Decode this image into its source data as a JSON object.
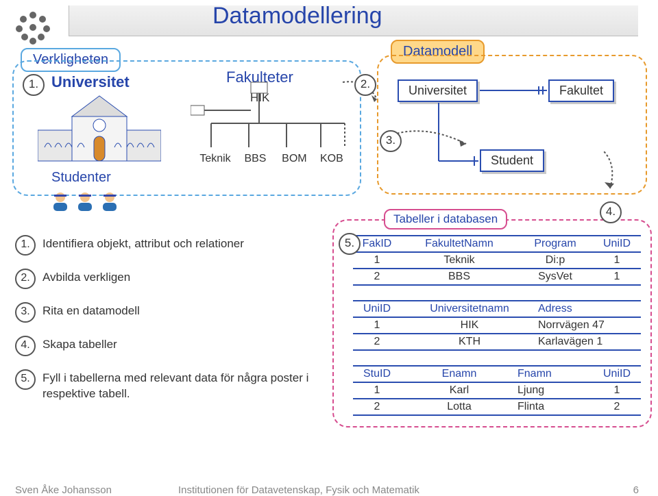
{
  "title": "Datamodellering",
  "tags": {
    "verkligheten": "Verkligheten",
    "datamodell": "Datamodell",
    "tabeller_db": "Tabeller i databasen"
  },
  "left": {
    "universitet": "Universitet",
    "fakulteter": "Fakulteter",
    "hik": "HIK",
    "depts": [
      "Teknik",
      "BBS",
      "BOM",
      "KOB"
    ],
    "studenter": "Studenter"
  },
  "er": {
    "universitet": "Universitet",
    "fakultet": "Fakultet",
    "student": "Student"
  },
  "circles": {
    "c1": "1.",
    "c2": "2.",
    "c3": "3.",
    "c4": "4.",
    "c5": "5."
  },
  "steps": [
    {
      "n": "1.",
      "text": "Identifiera objekt, attribut och relationer"
    },
    {
      "n": "2.",
      "text": "Avbilda verkligen"
    },
    {
      "n": "3.",
      "text": "Rita en datamodell"
    },
    {
      "n": "4.",
      "text": "Skapa tabeller"
    },
    {
      "n": "5.",
      "text": "Fyll i tabellerna med relevant data för några poster i respektive tabell."
    }
  ],
  "tables": {
    "fak": {
      "headers": [
        "FakID",
        "FakultetNamn",
        "Program",
        "UniID"
      ],
      "rows": [
        [
          "1",
          "Teknik",
          "Di:p",
          "1"
        ],
        [
          "2",
          "BBS",
          "SysVet",
          "1"
        ]
      ]
    },
    "uni": {
      "headers": [
        "UniID",
        "Universitetnamn",
        "Adress"
      ],
      "rows": [
        [
          "1",
          "HIK",
          "Norrvägen 47"
        ],
        [
          "2",
          "KTH",
          "Karlavägen 1"
        ]
      ]
    },
    "stu": {
      "headers": [
        "StuID",
        "Enamn",
        "Fnamn",
        "UniID"
      ],
      "rows": [
        [
          "1",
          "Karl",
          "Ljung",
          "1"
        ],
        [
          "2",
          "Lotta",
          "Flinta",
          "2"
        ]
      ]
    }
  },
  "footer": {
    "author": "Sven Åke Johansson",
    "inst": "Institutionen för Datavetenskap, Fysik och Matematik",
    "page": "6"
  }
}
